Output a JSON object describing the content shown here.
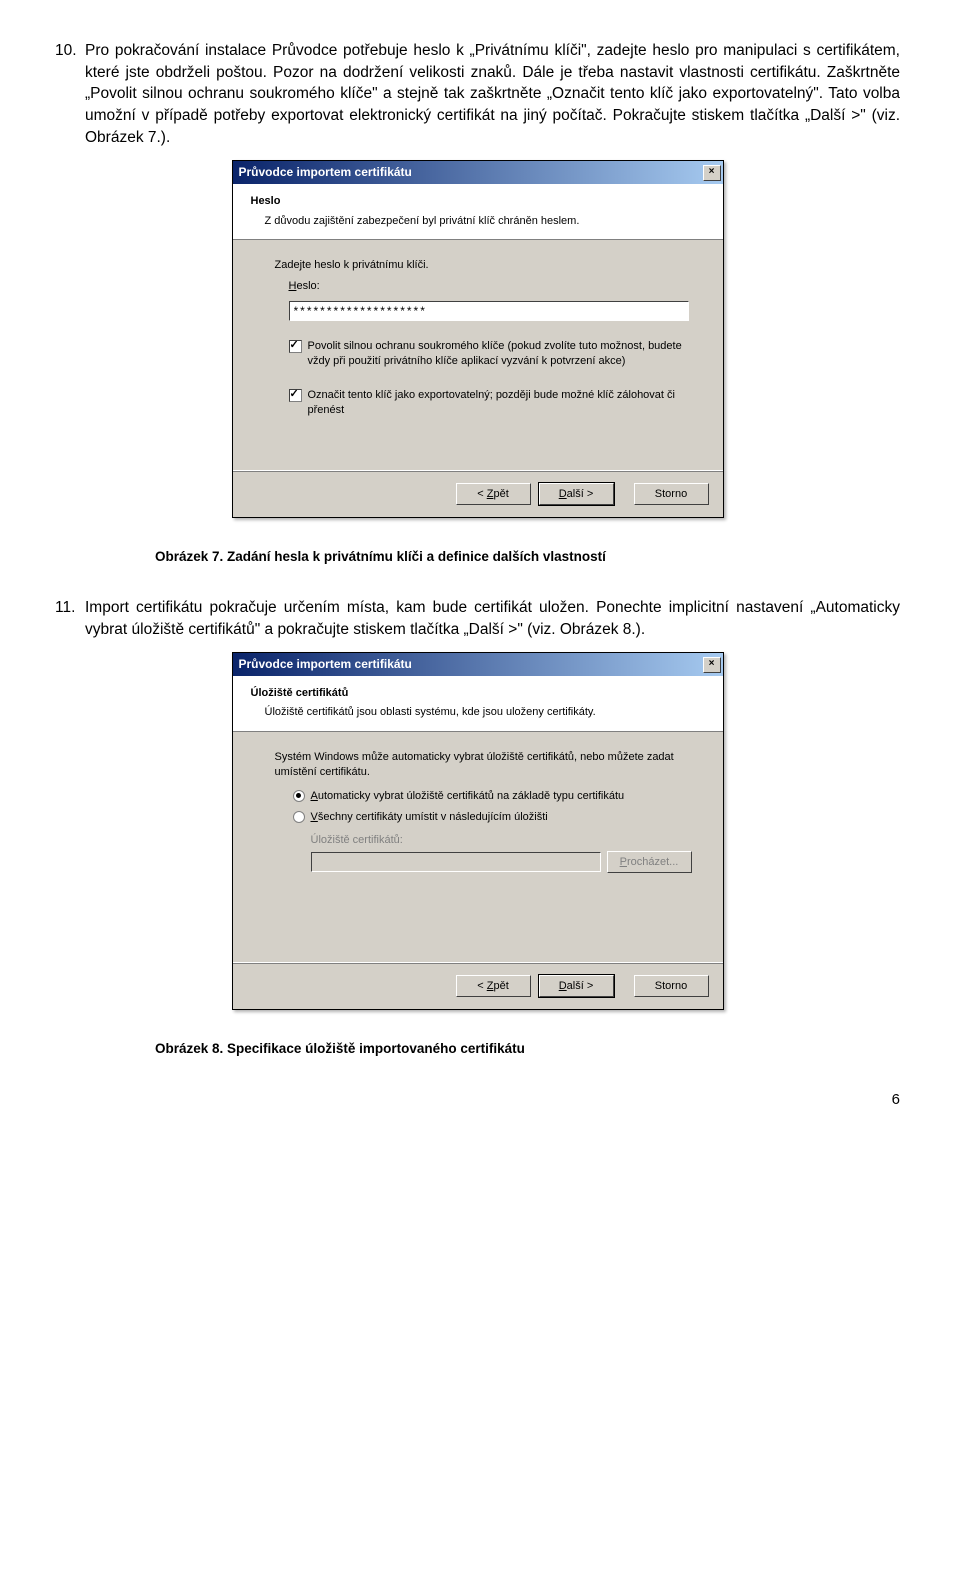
{
  "para10": {
    "num": "10.",
    "text": "Pro pokračování instalace Průvodce potřebuje heslo k „Privátnímu klíči\", zadejte heslo pro manipulaci s certifikátem, které jste obdrželi poštou. Pozor na dodržení velikosti znaků. Dále je třeba nastavit vlastnosti certifikátu. Zaškrtněte „Povolit silnou ochranu soukromého klíče\" a stejně tak zaškrtněte „Označit tento klíč jako exportovatelný\". Tato volba umožní v případě potřeby exportovat elektronický certifikát na jiný počítač. Pokračujte stiskem tlačítka „Další >\" (viz. Obrázek 7.)."
  },
  "dialog1": {
    "title": "Průvodce importem certifikátu",
    "h1": "Heslo",
    "h2": "Z důvodu zajištění zabezpečení byl privátní klíč chráněn heslem.",
    "prompt": "Zadejte heslo k privátnímu klíči.",
    "pwd_label_pre": "H",
    "pwd_label_post": "eslo:",
    "pwd_value": "********************",
    "cb1": "Povolit silnou ochranu soukromého klíče (pokud zvolíte tuto možnost, budete vždy při použití privátního klíče aplikací vyzvání k potvrzení akce)",
    "cb2": "Označit tento klíč jako exportovatelný; později bude možné klíč zálohovat či přenést",
    "back_pre": "< ",
    "back_u": "Z",
    "back_post": "pět",
    "next_pre": "",
    "next_u": "D",
    "next_post": "alší >",
    "cancel": "Storno"
  },
  "caption7": "Obrázek 7. Zadání hesla k privátnímu klíči a definice dalších vlastností",
  "para11": {
    "num": "11.",
    "text": "Import certifikátu pokračuje určením místa, kam bude certifikát uložen. Ponechte implicitní nastavení „Automaticky vybrat úložiště certifikátů\" a pokračujte stiskem tlačítka „Další >\" (viz. Obrázek 8.)."
  },
  "dialog2": {
    "title": "Průvodce importem certifikátu",
    "h1": "Úložiště certifikátů",
    "h2": "Úložiště certifikátů jsou oblasti systému, kde jsou uloženy certifikáty.",
    "prompt": "Systém Windows může automaticky vybrat úložiště certifikátů, nebo můžete zadat umístění certifikátu.",
    "r1_pre": "",
    "r1_u": "A",
    "r1_post": "utomaticky vybrat úložiště certifikátů na základě typu certifikátu",
    "r2_pre": "",
    "r2_u": "V",
    "r2_post": "šechny certifikáty umístit v následujícím úložišti",
    "store_label": "Úložiště certifikátů:",
    "browse_pre": "",
    "browse_u": "P",
    "browse_post": "rocházet...",
    "back_pre": "< ",
    "back_u": "Z",
    "back_post": "pět",
    "next_u": "D",
    "next_post": "alší >",
    "cancel": "Storno"
  },
  "caption8": "Obrázek 8. Specifikace úložiště importovaného certifikátu",
  "pagenum": "6"
}
